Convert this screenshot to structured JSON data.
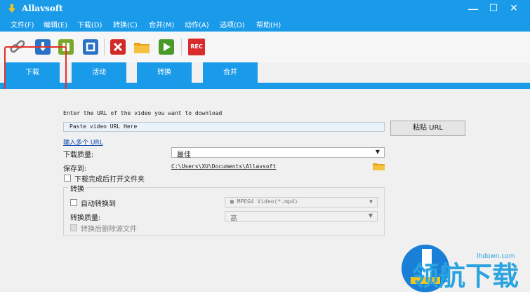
{
  "window": {
    "title": "Allavsoft",
    "minimize": "—",
    "maximize": "☐",
    "close": "✕"
  },
  "menu": [
    "文件(F)",
    "编辑(E)",
    "下载(D)",
    "转换(C)",
    "合并(M)",
    "动作(A)",
    "选项(O)",
    "帮助(H)"
  ],
  "toolbar": {
    "rec_label": "REC",
    "colors": {
      "download": "#2a72c7",
      "pause": "#7ba82b",
      "stop": "#2a72c7",
      "cancel": "#d12828",
      "folder": "#f0b429",
      "play": "#4a9a2a",
      "rec": "#d92b2b"
    }
  },
  "tabs": [
    "下载",
    "活动",
    "转换",
    "合并"
  ],
  "form": {
    "url_prompt": "Enter the URL of the video you want to download",
    "url_placeholder": "Paste video URL Here",
    "paste_button": "粘贴 URL",
    "multi_url_link": "输入多个 URL",
    "quality_label": "下载质量:",
    "quality_value": "最佳",
    "save_label": "保存到:",
    "save_path": "C:\\Users\\XU\\Documents\\Allavsoft",
    "open_folder_label": "下载完成后打开文件夹",
    "convert_group": "转换",
    "auto_convert_label": "自动转换到",
    "format_value": "MPEG4 Video(*.mp4)",
    "convert_quality_label": "转换质量:",
    "convert_quality_value": "高",
    "delete_source_label": "转换后删除源文件"
  },
  "watermark": {
    "text": "领航下载",
    "site": "lhdown.com"
  },
  "accent": "#1a9bea",
  "annotation_color": "#e2302b"
}
